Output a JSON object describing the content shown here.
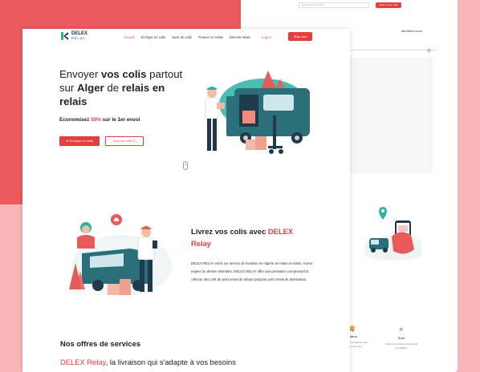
{
  "colors": {
    "accent": "#e43f3f",
    "red_bg": "#ea5a5f",
    "pink_bg": "#f7b7ba",
    "teal": "#2bb3a6",
    "navy": "#1f3a4a"
  },
  "back_page": {
    "search_placeholder": "Recherchez un colis",
    "button_label": "Suivre votre colis",
    "nav_text": "identifiez-vous",
    "services": [
      {
        "icon": "truck-icon",
        "title": "Livraison",
        "desc": "Nous assurons la collecte et la livraison de vos colis."
      },
      {
        "icon": "magnifier-icon",
        "title": "Suivi",
        "desc": "Suivez vos colis en temps réel sur DELEX"
      }
    ]
  },
  "nav": {
    "logo_title": "DELEX",
    "logo_sub": "RELAY",
    "links": [
      "Accueil",
      "Envoyer un colis",
      "Suivi de colis",
      "Trouver un relais",
      "Devenir relais"
    ],
    "login": "Log in",
    "ship_now": "Ship now"
  },
  "hero": {
    "line1_a": "Envoyer ",
    "line1_b": "vos colis",
    "line1_c": " partout",
    "line2_a": "sur ",
    "line2_b": "Alger",
    "line2_c": " de ",
    "line2_d": "relais en",
    "line3": "relais",
    "econ_a": "Economisez ",
    "econ_pct": "50%",
    "econ_b": " sur le 1er envoi",
    "btn_send": "Envoyer un colis",
    "btn_track": "Suivi de colis"
  },
  "about": {
    "title_a": "Livrez vos colis avec ",
    "title_b": "DELEX",
    "title_c": "Relay",
    "body": "DELEX RELAY est le 1er service de livraison en Algérie de relais en relais. Acteur majeur du dernier kilomètre, DELEX RELAY offre une prestation comprenant la collecte des colis de point relais de départ jusqu'au point relais de destination."
  },
  "services": {
    "title": "Nos offres de services",
    "sub_a": "DELEX Relay",
    "sub_b": ", la livraison qui s'adapte à vos besoins"
  }
}
